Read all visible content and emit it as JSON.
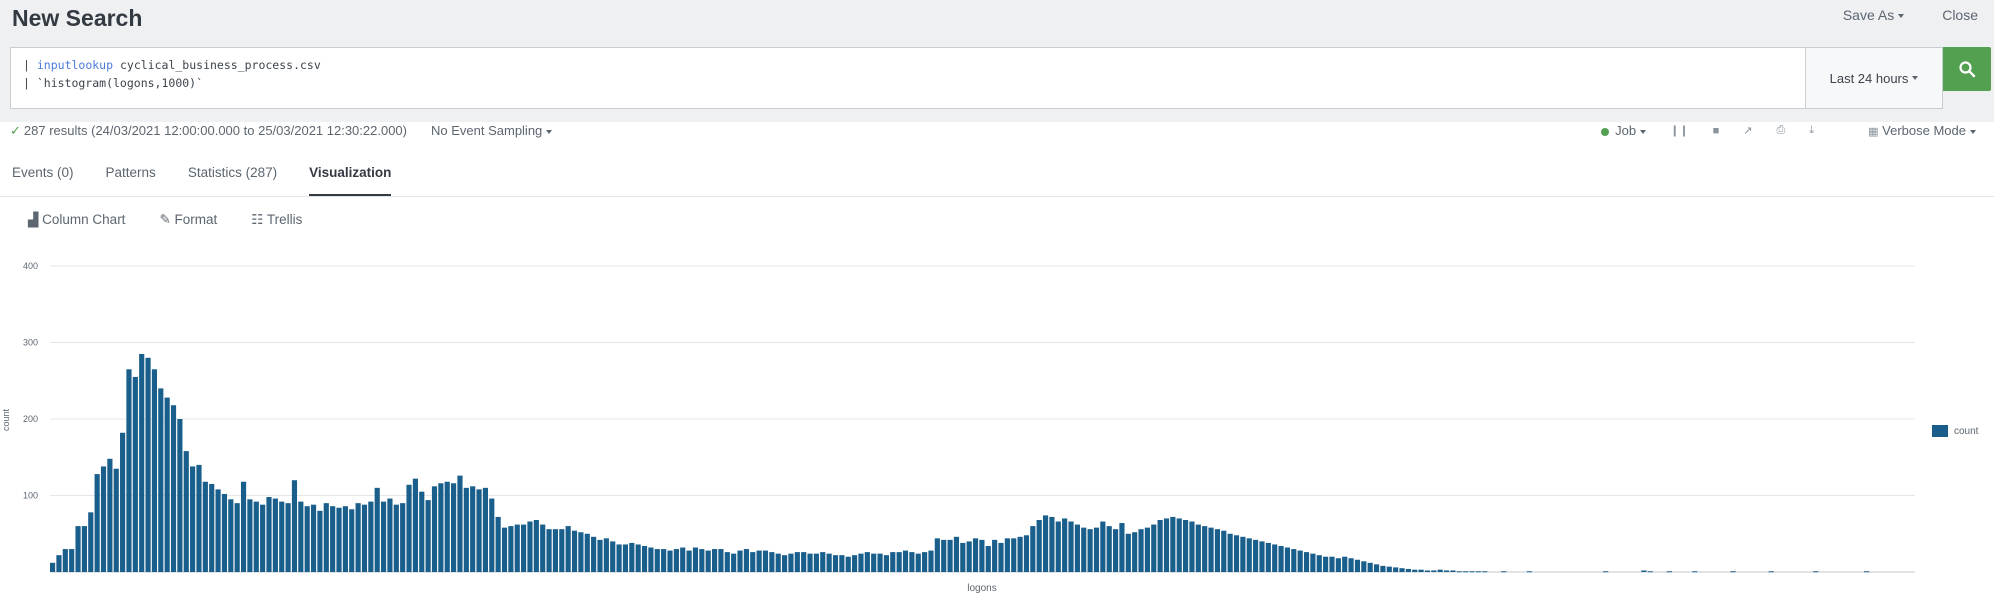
{
  "header": {
    "title": "New Search",
    "save_as_label": "Save As",
    "close_label": "Close"
  },
  "search": {
    "query_line1_pipe": "|",
    "query_line1_command": "inputlookup",
    "query_line1_arg": "cyclical_business_process.csv",
    "query_line2": "| `histogram(logons,1000)`",
    "time_range_label": "Last 24 hours"
  },
  "status": {
    "results_text": "287 results (24/03/2021 12:00:00.000 to 25/03/2021 12:30:22.000)",
    "sampling_label": "No Event Sampling",
    "job_label": "Job",
    "mode_label": "Verbose Mode"
  },
  "tabs": [
    {
      "label": "Events (0)"
    },
    {
      "label": "Patterns"
    },
    {
      "label": "Statistics (287)"
    },
    {
      "label": "Visualization",
      "active": true
    }
  ],
  "viz_toolbar": {
    "chart_type_label": "Column Chart",
    "format_label": "Format",
    "trellis_label": "Trellis"
  },
  "colors": {
    "bar": "#1a5f8c",
    "accent_green": "#53a051",
    "gridline": "#e4e7ea"
  },
  "chart_data": {
    "type": "bar",
    "xlabel": "logons",
    "ylabel": "count",
    "ylim": [
      0,
      400
    ],
    "yticks": [
      100,
      200,
      300,
      400
    ],
    "legend_position": "right",
    "grid": true,
    "series": [
      {
        "name": "count",
        "values": [
          12,
          22,
          30,
          30,
          60,
          60,
          78,
          128,
          138,
          148,
          135,
          182,
          265,
          255,
          285,
          280,
          265,
          240,
          228,
          218,
          200,
          158,
          138,
          140,
          118,
          115,
          108,
          102,
          95,
          90,
          118,
          95,
          92,
          88,
          98,
          96,
          92,
          90,
          120,
          92,
          86,
          88,
          80,
          90,
          86,
          84,
          86,
          82,
          90,
          88,
          92,
          110,
          92,
          96,
          88,
          90,
          114,
          122,
          105,
          94,
          112,
          116,
          118,
          116,
          126,
          110,
          112,
          108,
          110,
          96,
          72,
          58,
          60,
          62,
          62,
          66,
          68,
          62,
          56,
          56,
          56,
          60,
          54,
          52,
          50,
          46,
          42,
          44,
          40,
          36,
          36,
          38,
          36,
          34,
          32,
          30,
          30,
          28,
          30,
          32,
          28,
          32,
          30,
          28,
          30,
          30,
          26,
          24,
          28,
          30,
          26,
          28,
          28,
          26,
          24,
          22,
          24,
          26,
          26,
          24,
          24,
          26,
          24,
          22,
          22,
          20,
          22,
          24,
          26,
          24,
          24,
          22,
          26,
          26,
          28,
          26,
          24,
          26,
          28,
          44,
          42,
          42,
          46,
          38,
          40,
          44,
          42,
          34,
          42,
          38,
          44,
          44,
          46,
          48,
          60,
          68,
          74,
          72,
          66,
          70,
          66,
          62,
          58,
          56,
          58,
          66,
          60,
          56,
          64,
          50,
          52,
          56,
          58,
          62,
          68,
          70,
          72,
          70,
          68,
          66,
          62,
          60,
          58,
          56,
          54,
          50,
          48,
          46,
          44,
          42,
          40,
          38,
          36,
          34,
          32,
          30,
          28,
          26,
          24,
          22,
          20,
          20,
          18,
          20,
          18,
          16,
          14,
          12,
          10,
          8,
          7,
          6,
          5,
          4,
          3,
          3,
          2,
          2,
          3,
          2,
          2,
          1,
          1,
          1,
          1,
          1,
          0,
          0,
          1,
          0,
          0,
          0,
          1,
          0,
          0,
          0,
          0,
          0,
          0,
          0,
          0,
          0,
          0,
          0,
          1,
          0,
          0,
          0,
          0,
          0,
          2,
          1,
          0,
          0,
          1,
          0,
          0,
          0,
          1,
          0,
          0,
          0,
          0,
          0,
          1,
          0,
          0,
          0,
          0,
          0,
          1,
          0,
          0,
          0,
          0,
          0,
          0,
          1,
          0,
          0,
          0,
          0,
          0,
          0,
          0,
          1,
          0,
          0,
          0,
          0,
          0,
          0,
          0
        ]
      }
    ]
  }
}
